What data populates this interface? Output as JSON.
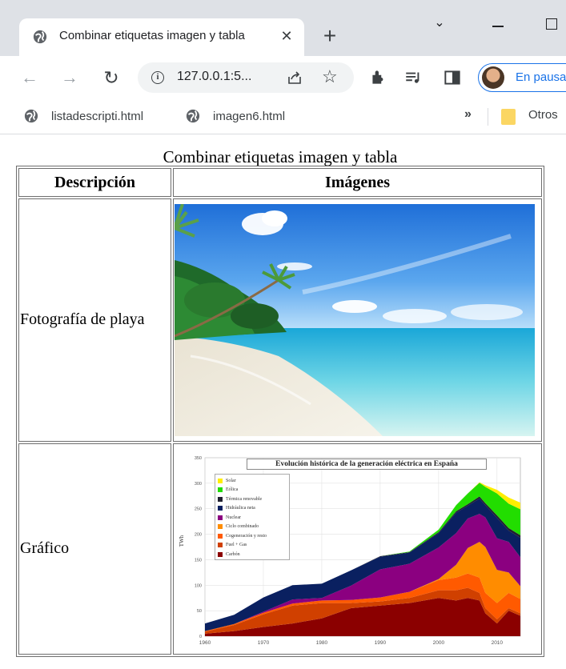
{
  "browser": {
    "tab_title": "Combinar etiquetas imagen y tabla",
    "close_glyph": "✕",
    "new_tab_glyph": "+",
    "chevron_glyph": "⌄",
    "url": "127.0.0.1:5...",
    "profile_label": "En pausa",
    "bookmarks": [
      {
        "label": "listadescripti.html"
      },
      {
        "label": "imagen6.html"
      }
    ],
    "more_glyph": "»",
    "other_bookmarks": "Otros"
  },
  "page": {
    "caption": "Combinar etiquetas imagen y tabla",
    "headers": [
      "Descripción",
      "Imágenes"
    ],
    "rows": [
      {
        "description": "Fotografía de playa"
      },
      {
        "description": "Gráfico"
      }
    ]
  },
  "chart_data": {
    "type": "area",
    "title": "Evolución histórica de la generación eléctrica en España",
    "ylabel": "TWh",
    "xlabel": "",
    "x_ticks": [
      1960,
      1970,
      1980,
      1990,
      2000,
      2010
    ],
    "y_ticks": [
      0,
      50,
      100,
      150,
      200,
      250,
      300,
      350
    ],
    "ylim": [
      0,
      350
    ],
    "xlim": [
      1960,
      2014
    ],
    "legend_position": "top-left",
    "x": [
      1960,
      1965,
      1970,
      1975,
      1980,
      1985,
      1990,
      1995,
      2000,
      2003,
      2005,
      2007,
      2008,
      2010,
      2012,
      2014
    ],
    "series": [
      {
        "name": "Carbón",
        "color": "#8b0000",
        "values": [
          5,
          10,
          18,
          25,
          35,
          55,
          60,
          65,
          75,
          70,
          75,
          70,
          45,
          25,
          50,
          40
        ]
      },
      {
        "name": "Fuel + Gas",
        "color": "#d04000",
        "values": [
          4,
          12,
          25,
          35,
          30,
          10,
          8,
          10,
          15,
          20,
          20,
          15,
          10,
          8,
          5,
          5
        ]
      },
      {
        "name": "Cogeneración y resto",
        "color": "#ff5a00",
        "values": [
          1,
          2,
          3,
          4,
          5,
          6,
          8,
          12,
          20,
          25,
          28,
          30,
          30,
          32,
          30,
          28
        ]
      },
      {
        "name": "Ciclo combinado",
        "color": "#ff8c00",
        "values": [
          0,
          0,
          0,
          0,
          0,
          0,
          0,
          0,
          2,
          25,
          50,
          70,
          90,
          65,
          40,
          25
        ]
      },
      {
        "name": "Nuclear",
        "color": "#8b0080",
        "values": [
          0,
          0,
          2,
          8,
          5,
          28,
          55,
          55,
          62,
          62,
          58,
          55,
          58,
          62,
          60,
          57
        ]
      },
      {
        "name": "Hidráulica neta",
        "color": "#0a2060",
        "values": [
          15,
          18,
          28,
          28,
          28,
          30,
          25,
          22,
          28,
          40,
          25,
          30,
          24,
          40,
          22,
          38
        ]
      },
      {
        "name": "Térmica renovable",
        "color": "#202030",
        "values": [
          0,
          0,
          0,
          0,
          0,
          0,
          1,
          1,
          2,
          3,
          3,
          4,
          4,
          5,
          5,
          5
        ]
      },
      {
        "name": "Eólica",
        "color": "#22dd00",
        "values": [
          0,
          0,
          0,
          0,
          0,
          0,
          0,
          1,
          5,
          12,
          21,
          27,
          32,
          43,
          48,
          51
        ]
      },
      {
        "name": "Solar",
        "color": "#ffee00",
        "values": [
          0,
          0,
          0,
          0,
          0,
          0,
          0,
          0,
          0,
          0,
          0,
          1,
          3,
          7,
          12,
          13
        ]
      }
    ]
  },
  "colors": {
    "accent": "#1a73e8",
    "chrome_bg": "#dee1e6",
    "omnibox_bg": "#f1f3f4"
  }
}
